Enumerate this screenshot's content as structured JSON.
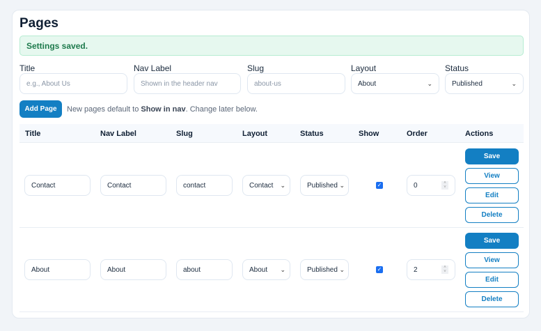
{
  "title": "Pages",
  "alert": "Settings saved.",
  "form": {
    "title_label": "Title",
    "title_placeholder": "e.g., About Us",
    "nav_label": "Nav Label",
    "nav_placeholder": "Shown in the header nav",
    "slug_label": "Slug",
    "slug_placeholder": "about-us",
    "layout_label": "Layout",
    "layout_value": "About",
    "status_label": "Status",
    "status_value": "Published",
    "add_button": "Add Page",
    "hint_pre": "New pages default to ",
    "hint_bold": "Show in nav",
    "hint_post": ". Change later below."
  },
  "table": {
    "headers": [
      "Title",
      "Nav Label",
      "Slug",
      "Layout",
      "Status",
      "Show",
      "Order",
      "Actions"
    ],
    "rows": [
      {
        "title": "Contact",
        "nav": "Contact",
        "slug": "contact",
        "layout": "Contact",
        "status": "Published",
        "show": true,
        "order": "0"
      },
      {
        "title": "About",
        "nav": "About",
        "slug": "about",
        "layout": "About",
        "status": "Published",
        "show": true,
        "order": "2"
      }
    ],
    "actions": {
      "save": "Save",
      "view": "View",
      "edit": "Edit",
      "delete": "Delete"
    }
  },
  "colors": {
    "primary": "#137fc3",
    "success_bg": "#e6f8ef",
    "success_text": "#1d7a4c"
  }
}
